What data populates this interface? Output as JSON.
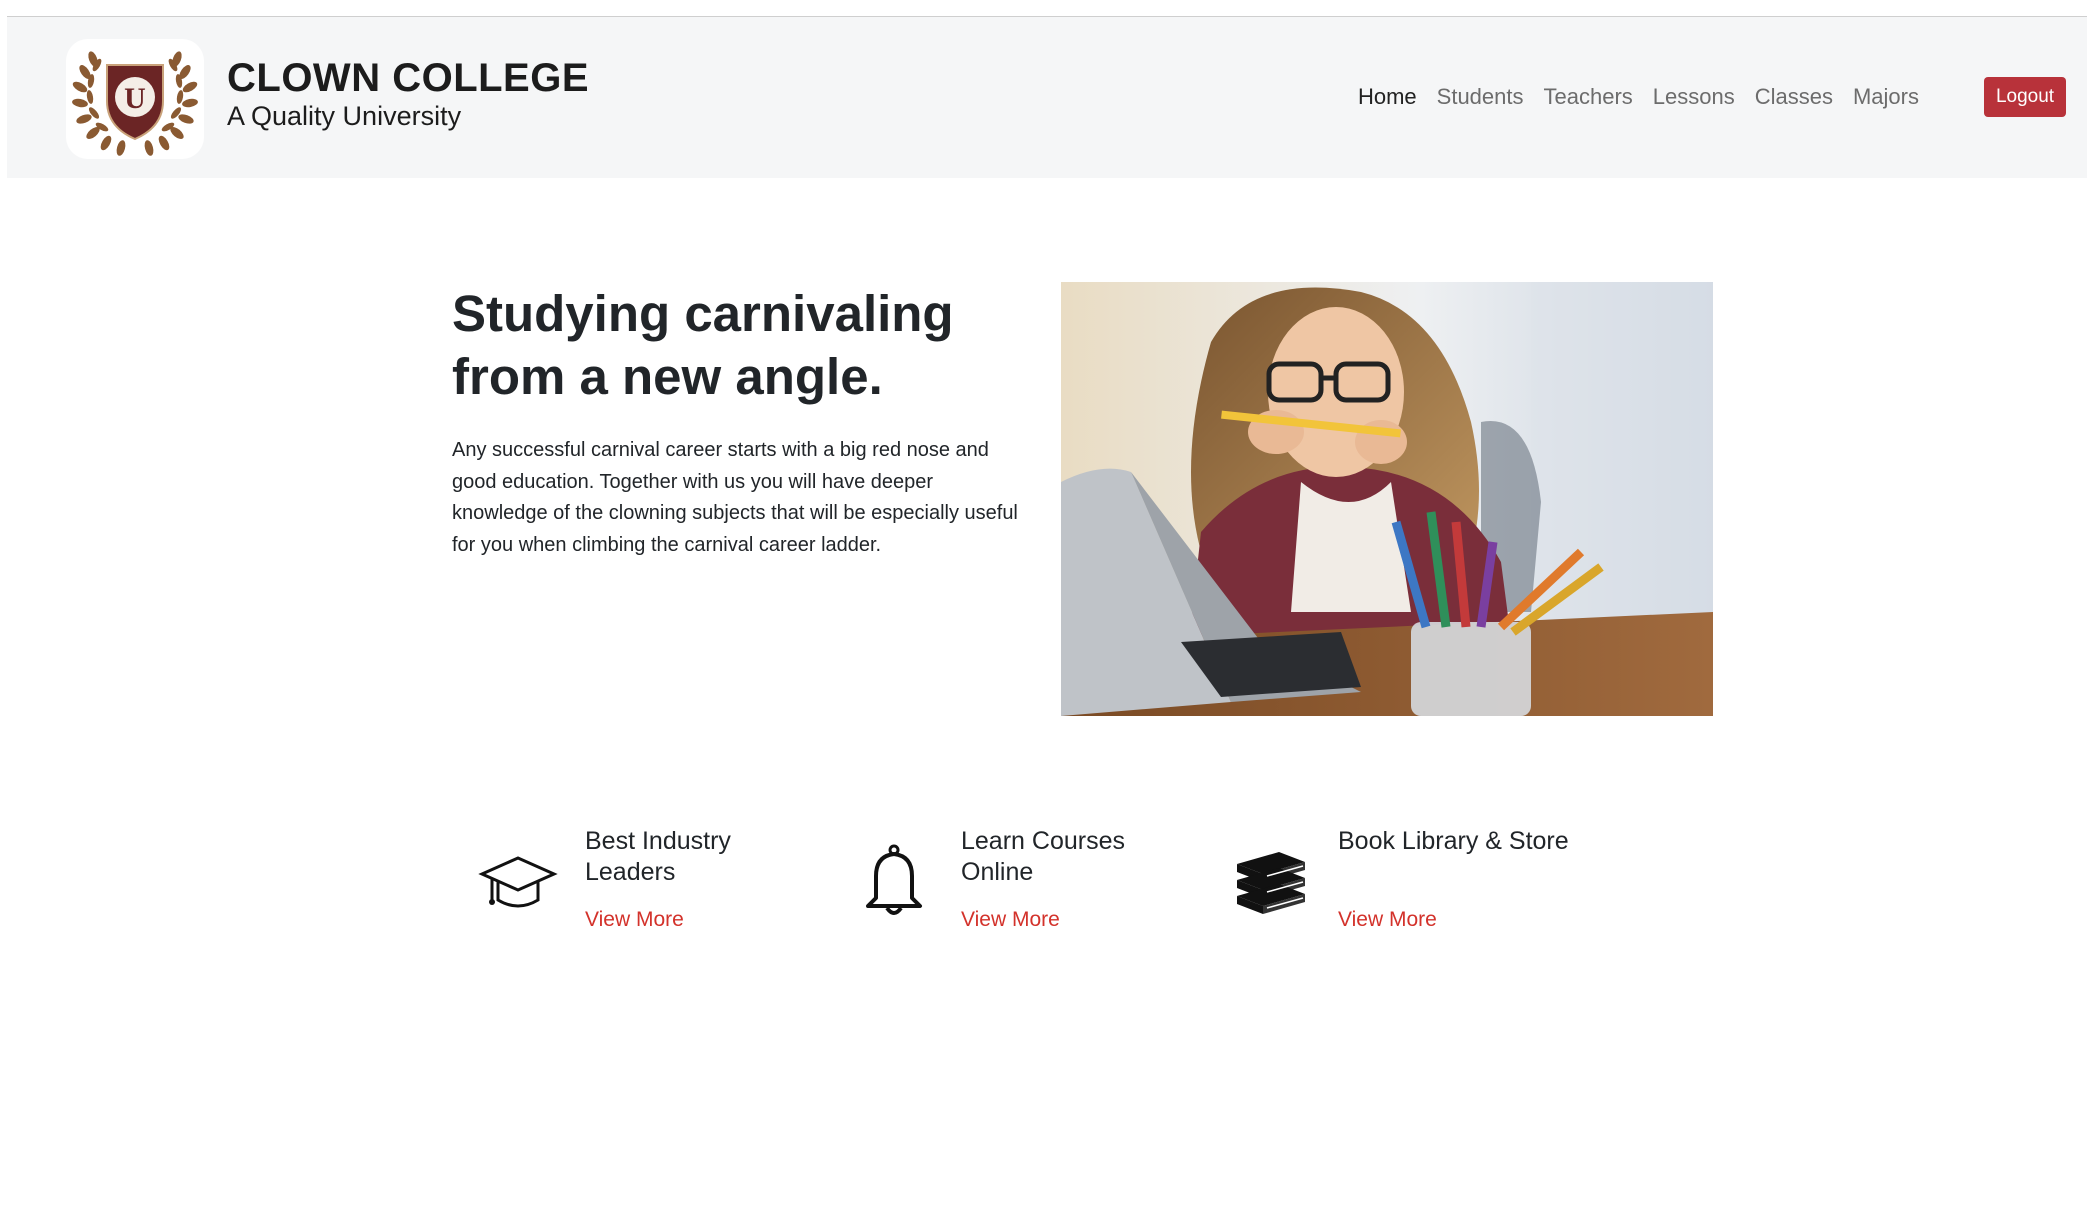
{
  "brand": {
    "logo_letter": "U",
    "title": "CLOWN COLLEGE",
    "subtitle": "A Quality University"
  },
  "nav": {
    "items": [
      {
        "label": "Home",
        "active": true
      },
      {
        "label": "Students",
        "active": false
      },
      {
        "label": "Teachers",
        "active": false
      },
      {
        "label": "Lessons",
        "active": false
      },
      {
        "label": "Classes",
        "active": false
      },
      {
        "label": "Majors",
        "active": false
      }
    ],
    "logout_label": "Logout"
  },
  "hero": {
    "title": "Studying carnivaling from a new angle.",
    "text": "Any successful carnival career starts with a big red nose and good education. Together with us you will have deeper knowledge of the clowning subjects that will be especially useful for you when climbing the carnival career ladder."
  },
  "features": [
    {
      "icon": "graduation-cap-icon",
      "title": "Best Industry Leaders",
      "link": "View More"
    },
    {
      "icon": "bell-icon",
      "title": "Learn Courses Online",
      "link": "View More"
    },
    {
      "icon": "books-icon",
      "title": "Book Library & Store",
      "link": "View More"
    }
  ],
  "colors": {
    "navbar_bg": "#f5f6f7",
    "logout_bg": "#b8323a",
    "link": "#d3322b",
    "shield": "#6b2525",
    "laurel": "#8a5a32"
  }
}
